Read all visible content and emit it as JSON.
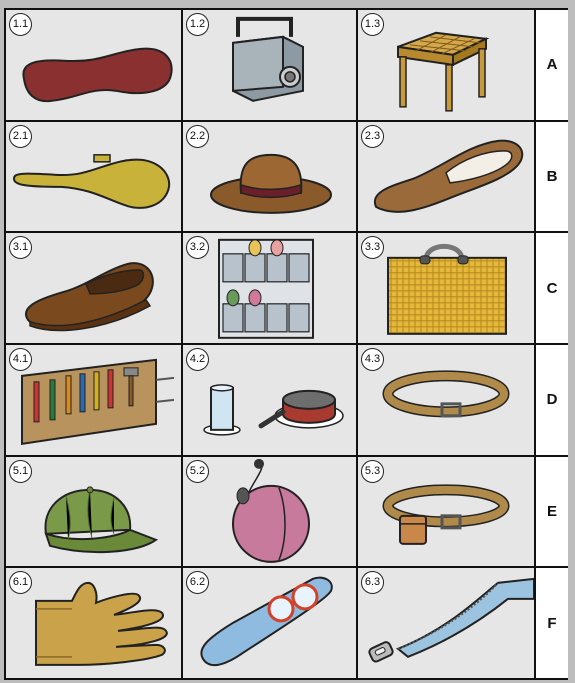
{
  "rows": [
    {
      "label": "A",
      "cells": [
        {
          "num": "1.1",
          "icon": "guitar-case-icon"
        },
        {
          "num": "1.2",
          "icon": "camera-icon"
        },
        {
          "num": "1.3",
          "icon": "stool-icon"
        }
      ]
    },
    {
      "label": "B",
      "cells": [
        {
          "num": "2.1",
          "icon": "guitar-case-icon"
        },
        {
          "num": "2.2",
          "icon": "hat-icon"
        },
        {
          "num": "2.3",
          "icon": "slipper-icon"
        }
      ]
    },
    {
      "label": "C",
      "cells": [
        {
          "num": "3.1",
          "icon": "loafer-icon"
        },
        {
          "num": "3.2",
          "icon": "shoe-organizer-icon"
        },
        {
          "num": "3.3",
          "icon": "woven-bag-icon"
        }
      ]
    },
    {
      "label": "D",
      "cells": [
        {
          "num": "4.1",
          "icon": "tool-roll-icon"
        },
        {
          "num": "4.2",
          "icon": "glass-and-pan-icon"
        },
        {
          "num": "4.3",
          "icon": "belt-icon"
        }
      ]
    },
    {
      "label": "E",
      "cells": [
        {
          "num": "5.1",
          "icon": "cap-icon"
        },
        {
          "num": "5.2",
          "icon": "perfume-bottle-icon"
        },
        {
          "num": "5.3",
          "icon": "belt-with-pouch-icon"
        }
      ]
    },
    {
      "label": "F",
      "cells": [
        {
          "num": "6.1",
          "icon": "glove-icon"
        },
        {
          "num": "6.2",
          "icon": "glasses-case-icon"
        },
        {
          "num": "6.3",
          "icon": "zipper-icon"
        }
      ]
    }
  ],
  "colors": {
    "frame": "#111111",
    "cell_bg": "#e6e6e6",
    "page_bg": "#bdbdbd"
  }
}
